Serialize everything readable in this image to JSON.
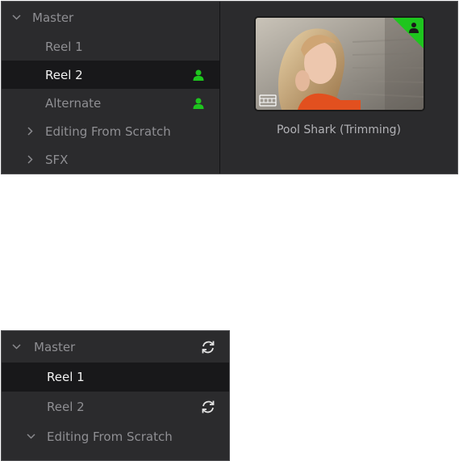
{
  "top_panel": {
    "bins": [
      {
        "label": "Master",
        "arrow": "chevron-down",
        "selected": false,
        "shared": false
      },
      {
        "label": "Reel 1",
        "arrow": "",
        "selected": false,
        "shared": false
      },
      {
        "label": "Reel 2",
        "arrow": "",
        "selected": true,
        "shared": true
      },
      {
        "label": "Alternate",
        "arrow": "",
        "selected": false,
        "shared": true
      },
      {
        "label": "Editing From Scratch",
        "arrow": "chevron-right",
        "selected": false,
        "shared": false
      },
      {
        "label": "SFX",
        "arrow": "chevron-right",
        "selected": false,
        "shared": false
      }
    ],
    "clip": {
      "name": "Pool Shark (Trimming)"
    }
  },
  "bottom_panel": {
    "bins": [
      {
        "label": "Master",
        "arrow": "chevron-down",
        "selected": false,
        "sync": true
      },
      {
        "label": "Reel 1",
        "arrow": "",
        "selected": true,
        "sync": false
      },
      {
        "label": "Reel 2",
        "arrow": "",
        "selected": false,
        "sync": true
      },
      {
        "label": "Editing From Scratch",
        "arrow": "chevron-down",
        "selected": false,
        "sync": false
      }
    ]
  },
  "colors": {
    "accent_green": "#1ec51e",
    "panel_bg": "#2b2b2d",
    "selected_bg": "#18181a"
  }
}
